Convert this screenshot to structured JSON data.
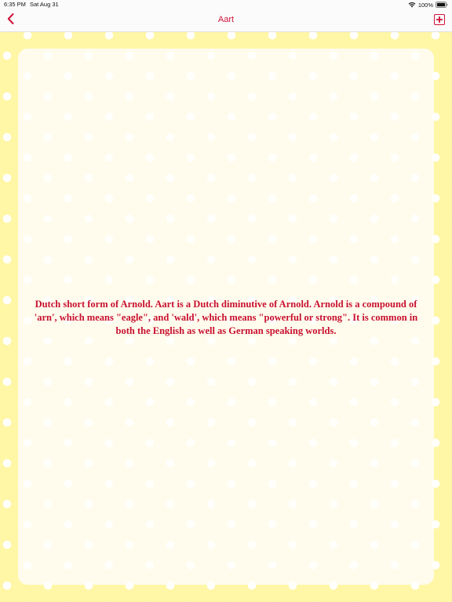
{
  "status_bar": {
    "time": "6:35 PM",
    "date": "Sat Aug 31",
    "battery": "100%"
  },
  "nav": {
    "title": "Aart",
    "back_icon": "chevron-left-icon",
    "add_icon": "plus-square-icon"
  },
  "content": {
    "description": "Dutch short form of Arnold. Aart is a Dutch diminutive of Arnold. Arnold is a compound of 'arn', which means \"eagle\", and 'wald', which means \"powerful or strong\". It is common in both the English as well as German speaking worlds."
  },
  "colors": {
    "accent": "#d0133a",
    "background": "#fff6a6",
    "card": "#fffced"
  }
}
